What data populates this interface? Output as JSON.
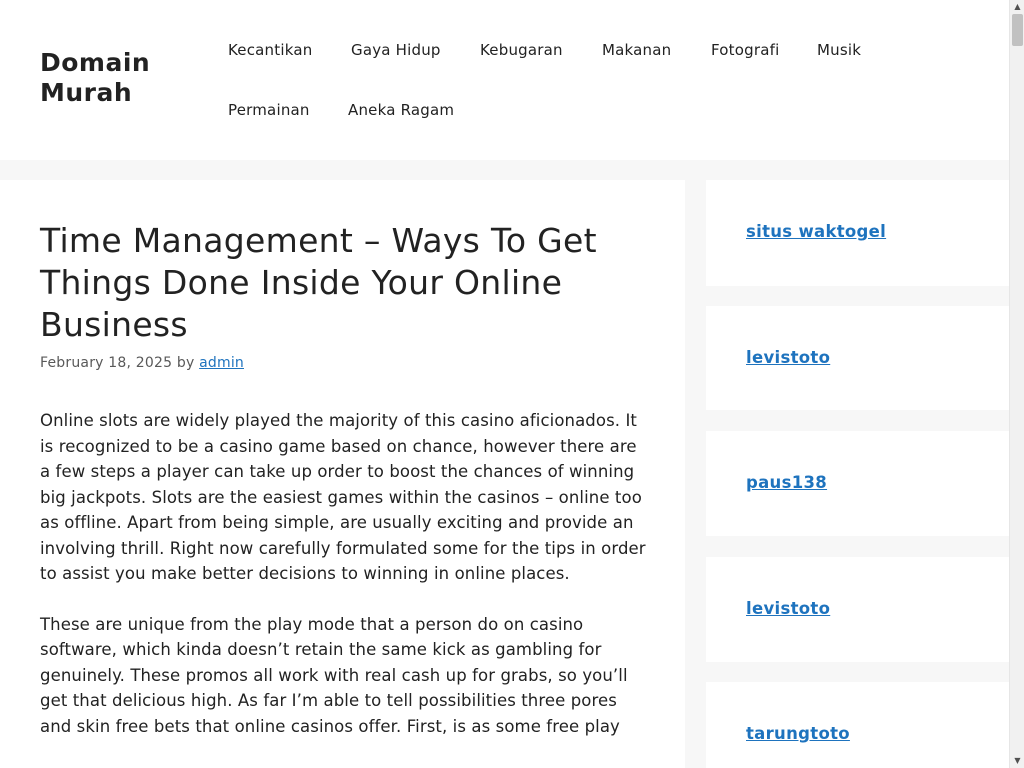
{
  "site": {
    "title": "Domain Murah"
  },
  "nav": {
    "items": [
      {
        "label": "Kecantikan"
      },
      {
        "label": "Gaya Hidup"
      },
      {
        "label": "Kebugaran"
      },
      {
        "label": "Makanan"
      },
      {
        "label": "Fotografi"
      },
      {
        "label": "Musik"
      },
      {
        "label": "Permainan"
      },
      {
        "label": "Aneka Ragam"
      }
    ]
  },
  "post": {
    "title": "Time Management – Ways To Get Things Done Inside Your Online Business",
    "date": "February 18, 2025",
    "by": "by",
    "author": "admin",
    "paragraphs": [
      "Online slots are widely played the majority of this casino aficionados. It is recognized to be a casino game based on chance, however there are a few steps a player can take up order to boost the chances of winning big jackpots. Slots are the easiest games within the casinos – online too as offline. Apart from being simple, are usually exciting and provide an involving thrill. Right now carefully formulated some for the tips in order to assist you make better decisions to winning in online places.",
      "These are unique from the play mode that a person do on casino software, which kinda doesn’t retain the same kick as gambling for genuinely. These promos all work with real cash up for grabs, so you’ll get that delicious high. As far I’m able to tell possibilities three pores and skin free bets that online casinos offer. First, is as some free play"
    ]
  },
  "sidebar": {
    "links": [
      {
        "label": "situs waktogel"
      },
      {
        "label": "levistoto"
      },
      {
        "label": "paus138"
      },
      {
        "label": "levistoto"
      },
      {
        "label": "tarungtoto"
      }
    ]
  },
  "colors": {
    "link": "#1e73be",
    "text": "#222222",
    "background": "#f7f7f7",
    "card": "#ffffff"
  },
  "icons": {
    "scroll_up": "triangle-up-icon",
    "scroll_down": "triangle-down-icon"
  }
}
